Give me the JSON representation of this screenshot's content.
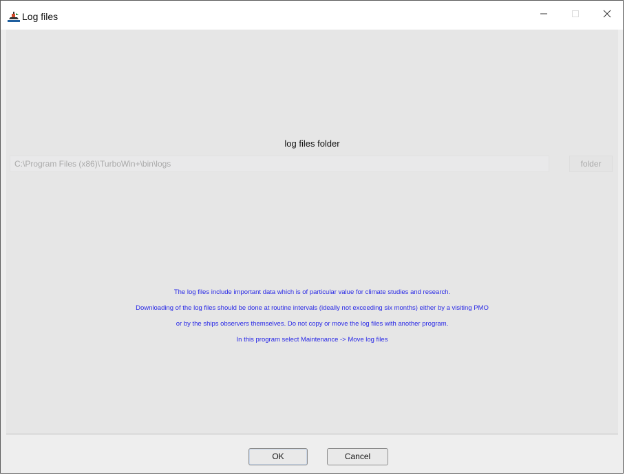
{
  "window": {
    "title": "Log files",
    "icon": "ship-icon",
    "controls": {
      "minimize": "—",
      "maximize": "□",
      "close": "✕"
    }
  },
  "main": {
    "folder_heading": "log files folder",
    "path_value": "C:\\Program Files (x86)\\TurboWin+\\bin\\logs",
    "folder_button": "folder",
    "info_lines": [
      "The log files include important data which is of particular value for climate studies and research.",
      "Downloading of the log files should be done at routine intervals (ideally not exceeding six months) either by a visiting PMO",
      "or by the ships observers themselves. Do not copy or move the log files with another program.",
      "In this program select Maintenance -> Move log files"
    ]
  },
  "footer": {
    "ok_label": "OK",
    "cancel_label": "Cancel"
  },
  "colors": {
    "info_text": "#2828e6",
    "disabled_text": "#aaaaaa",
    "background": "#e6e6e6"
  }
}
